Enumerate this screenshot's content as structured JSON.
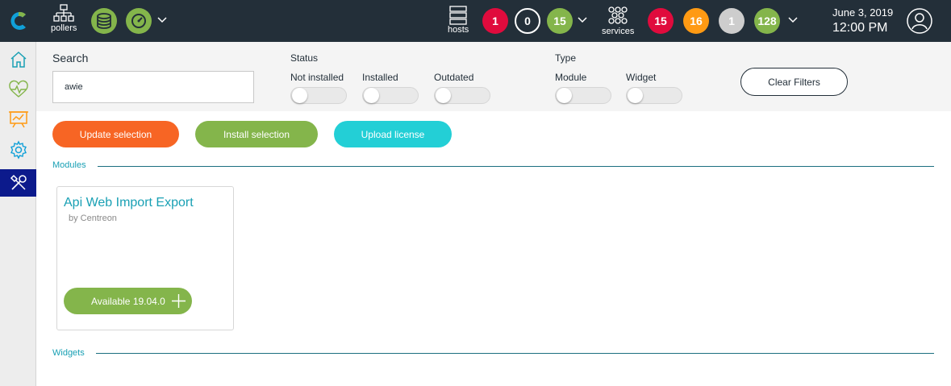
{
  "topbar": {
    "pollers_label": "pollers",
    "hosts_label": "hosts",
    "services_label": "services",
    "host_counts": [
      {
        "value": "1",
        "color": "#e00b3d"
      },
      {
        "value": "0",
        "color": "#232f39"
      },
      {
        "value": "15",
        "color": "#84b54b"
      }
    ],
    "service_counts": [
      {
        "value": "15",
        "color": "#e00b3d"
      },
      {
        "value": "16",
        "color": "#ff9a13"
      },
      {
        "value": "1",
        "color": "#cdcdcd"
      },
      {
        "value": "128",
        "color": "#84b54b"
      }
    ],
    "date": "June 3, 2019",
    "time": "12:00 PM"
  },
  "filters": {
    "search_label": "Search",
    "search_value": "awie",
    "status_title": "Status",
    "status_options": [
      "Not installed",
      "Installed",
      "Outdated"
    ],
    "type_title": "Type",
    "type_options": [
      "Module",
      "Widget"
    ],
    "clear_label": "Clear Filters"
  },
  "actions": {
    "update_label": "Update selection",
    "install_label": "Install selection",
    "upload_label": "Upload license"
  },
  "colors": {
    "orange": "#f76524",
    "green": "#84b54b",
    "teal": "#23cfd6",
    "accent": "#19a0b4"
  },
  "sections": {
    "modules_title": "Modules",
    "widgets_title": "Widgets"
  },
  "modules": [
    {
      "name": "Api Web Import Export",
      "author": "by Centreon",
      "status_label": "Available 19.04.0"
    }
  ]
}
